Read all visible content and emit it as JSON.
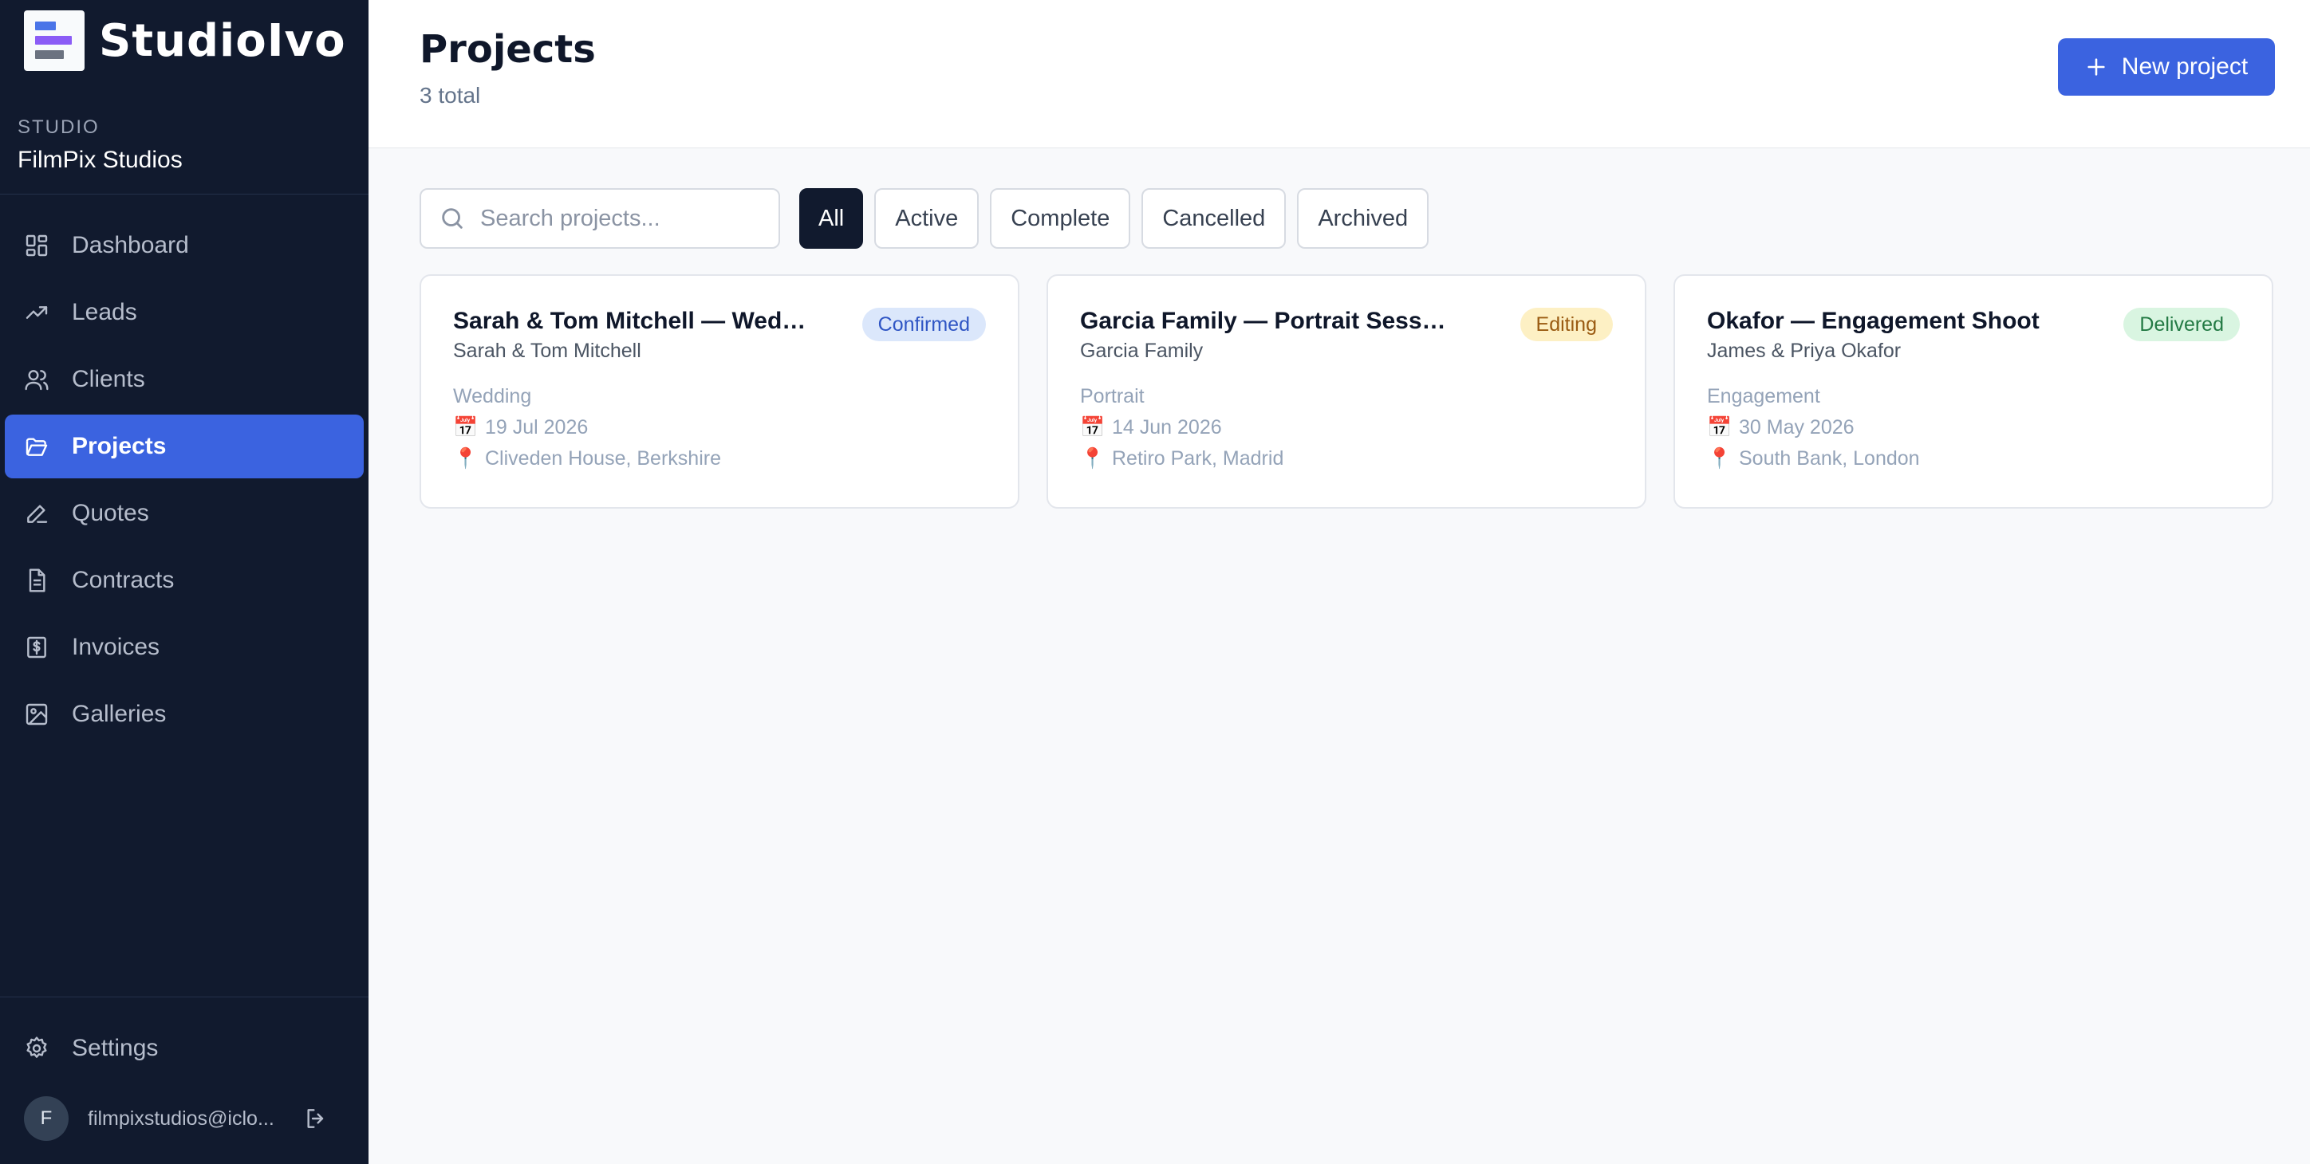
{
  "app": {
    "brand_name": "StudioIvo"
  },
  "studio": {
    "label": "STUDIO",
    "name": "FilmPix Studios"
  },
  "nav": {
    "items": [
      {
        "label": "Dashboard",
        "icon": "dashboard-icon",
        "active": false
      },
      {
        "label": "Leads",
        "icon": "trending-up-icon",
        "active": false
      },
      {
        "label": "Clients",
        "icon": "users-icon",
        "active": false
      },
      {
        "label": "Projects",
        "icon": "folder-open-icon",
        "active": true
      },
      {
        "label": "Quotes",
        "icon": "pen-icon",
        "active": false
      },
      {
        "label": "Contracts",
        "icon": "document-icon",
        "active": false
      },
      {
        "label": "Invoices",
        "icon": "receipt-icon",
        "active": false
      },
      {
        "label": "Galleries",
        "icon": "image-icon",
        "active": false
      }
    ],
    "settings_label": "Settings"
  },
  "user": {
    "initial": "F",
    "email": "filmpixstudios@iclo..."
  },
  "header": {
    "title": "Projects",
    "subtitle": "3 total",
    "new_button_label": "New project"
  },
  "search": {
    "placeholder": "Search projects...",
    "value": ""
  },
  "filters": [
    {
      "label": "All",
      "active": true
    },
    {
      "label": "Active",
      "active": false
    },
    {
      "label": "Complete",
      "active": false
    },
    {
      "label": "Cancelled",
      "active": false
    },
    {
      "label": "Archived",
      "active": false
    }
  ],
  "projects": [
    {
      "title": "Sarah & Tom Mitchell — Weddi...",
      "client": "Sarah & Tom Mitchell",
      "status": "Confirmed",
      "type": "Wedding",
      "date": "19 Jul 2026",
      "location": "Cliveden House, Berkshire"
    },
    {
      "title": "Garcia Family — Portrait Session",
      "client": "Garcia Family",
      "status": "Editing",
      "type": "Portrait",
      "date": "14 Jun 2026",
      "location": "Retiro Park, Madrid"
    },
    {
      "title": "Okafor — Engagement Shoot",
      "client": "James & Priya Okafor",
      "status": "Delivered",
      "type": "Engagement",
      "date": "30 May 2026",
      "location": "South Bank, London"
    }
  ],
  "icons": {
    "date": "📅",
    "location": "📍"
  },
  "colors": {
    "sidebar_bg": "#111a2e",
    "accent": "#3b63e0",
    "status_confirmed_bg": "#dbe7fb",
    "status_confirmed_fg": "#2f55c4",
    "status_editing_bg": "#fdf0c4",
    "status_editing_fg": "#9a5b12",
    "status_delivered_bg": "#d9f5e1",
    "status_delivered_fg": "#237a44"
  }
}
